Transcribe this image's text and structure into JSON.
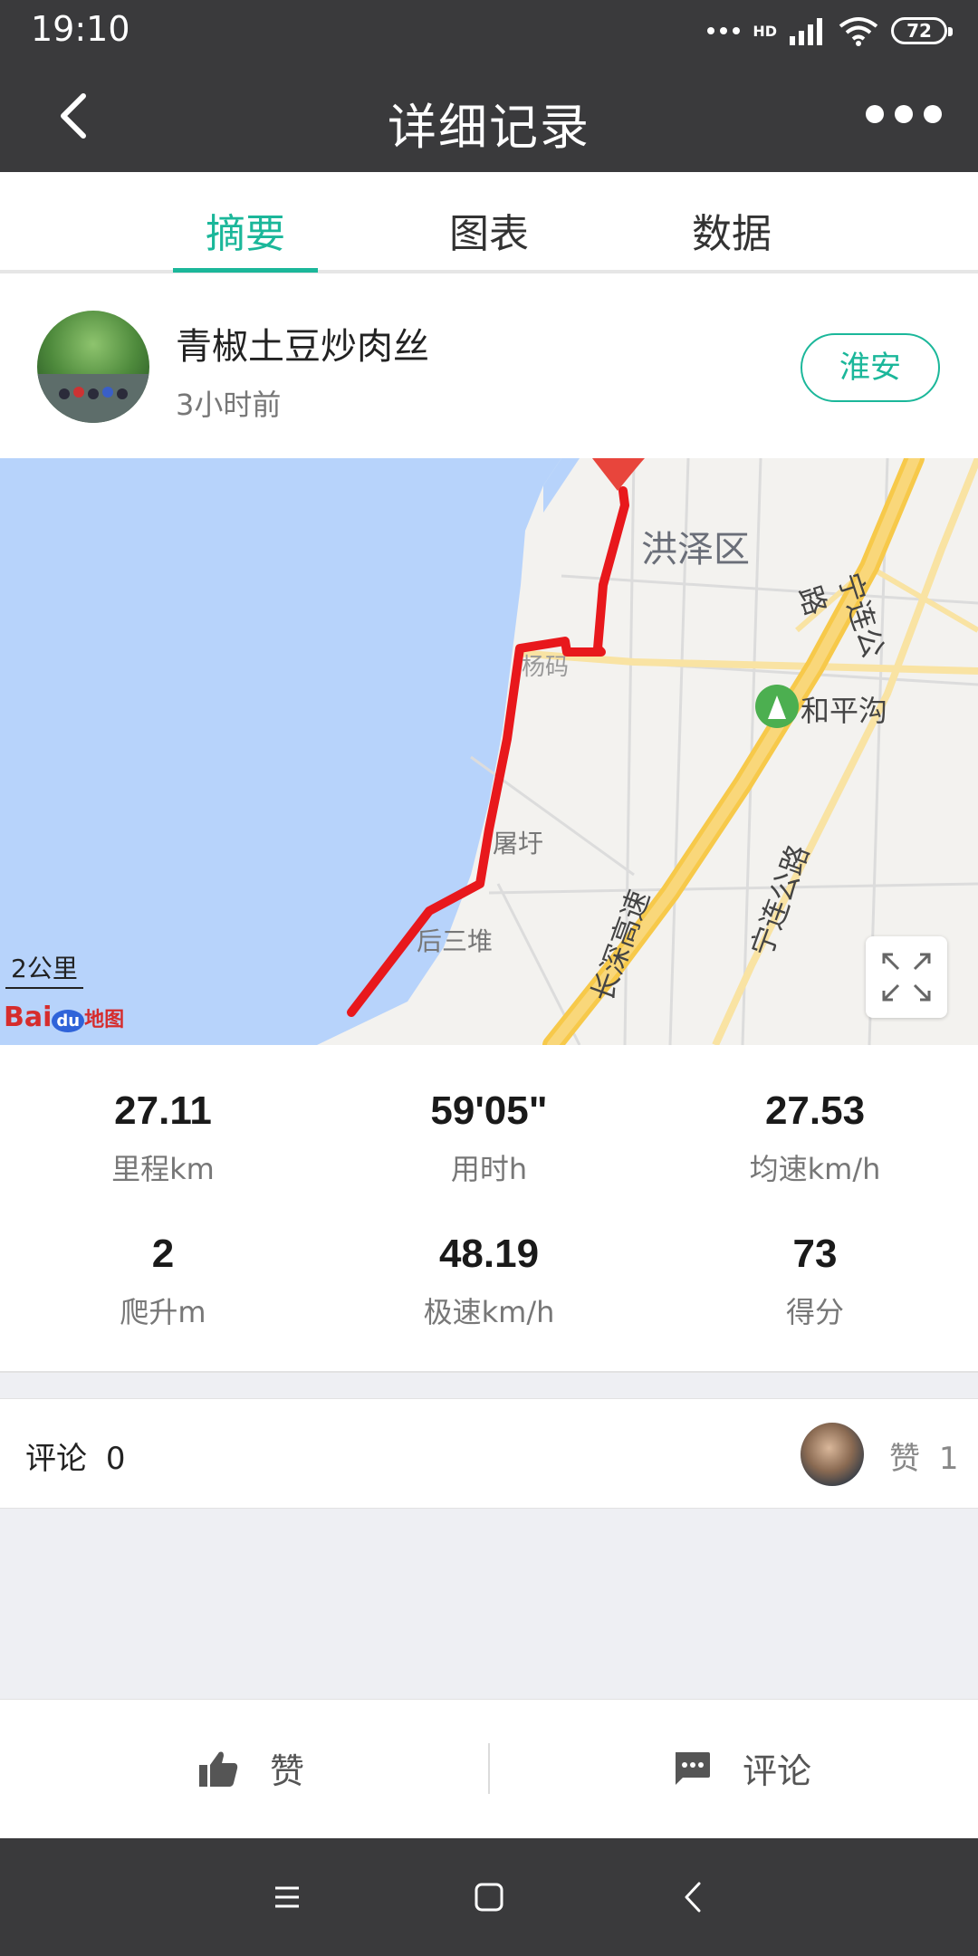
{
  "status_bar": {
    "time": "19:10",
    "network": "HD",
    "battery": "72"
  },
  "app_bar": {
    "title": "详细记录"
  },
  "tabs": [
    {
      "label": "摘要",
      "active": true
    },
    {
      "label": "图表",
      "active": false
    },
    {
      "label": "数据",
      "active": false
    }
  ],
  "user": {
    "name": "青椒土豆炒肉丝",
    "time_ago": "3小时前",
    "city": "淮安"
  },
  "map": {
    "labels": {
      "district": "洪泽区",
      "place1": "和平沟",
      "place2": "屠圩",
      "place3": "后三堆",
      "place4": "杨码",
      "road1": "宁连公路",
      "road2": "长深高速",
      "road3": "宁连公路"
    },
    "scale": "2公里",
    "logo_text": "Bai",
    "logo_du": "du",
    "logo_suffix": "地图",
    "colors": {
      "water": "#b7d3fb",
      "land": "#f3f2ef",
      "route": "#e8181c",
      "highway": "#f7c94a"
    }
  },
  "stats": [
    {
      "value": "27.11",
      "label": "里程km"
    },
    {
      "value": "59'05\"",
      "label": "用时h"
    },
    {
      "value": "27.53",
      "label": "均速km/h"
    },
    {
      "value": "2",
      "label": "爬升m"
    },
    {
      "value": "48.19",
      "label": "极速km/h"
    },
    {
      "value": "73",
      "label": "得分"
    }
  ],
  "comments": {
    "label": "评论",
    "count": "0",
    "like_label": "赞",
    "like_count": "1"
  },
  "actions": {
    "like": "赞",
    "comment": "评论"
  },
  "accent_color": "#1bb79a"
}
